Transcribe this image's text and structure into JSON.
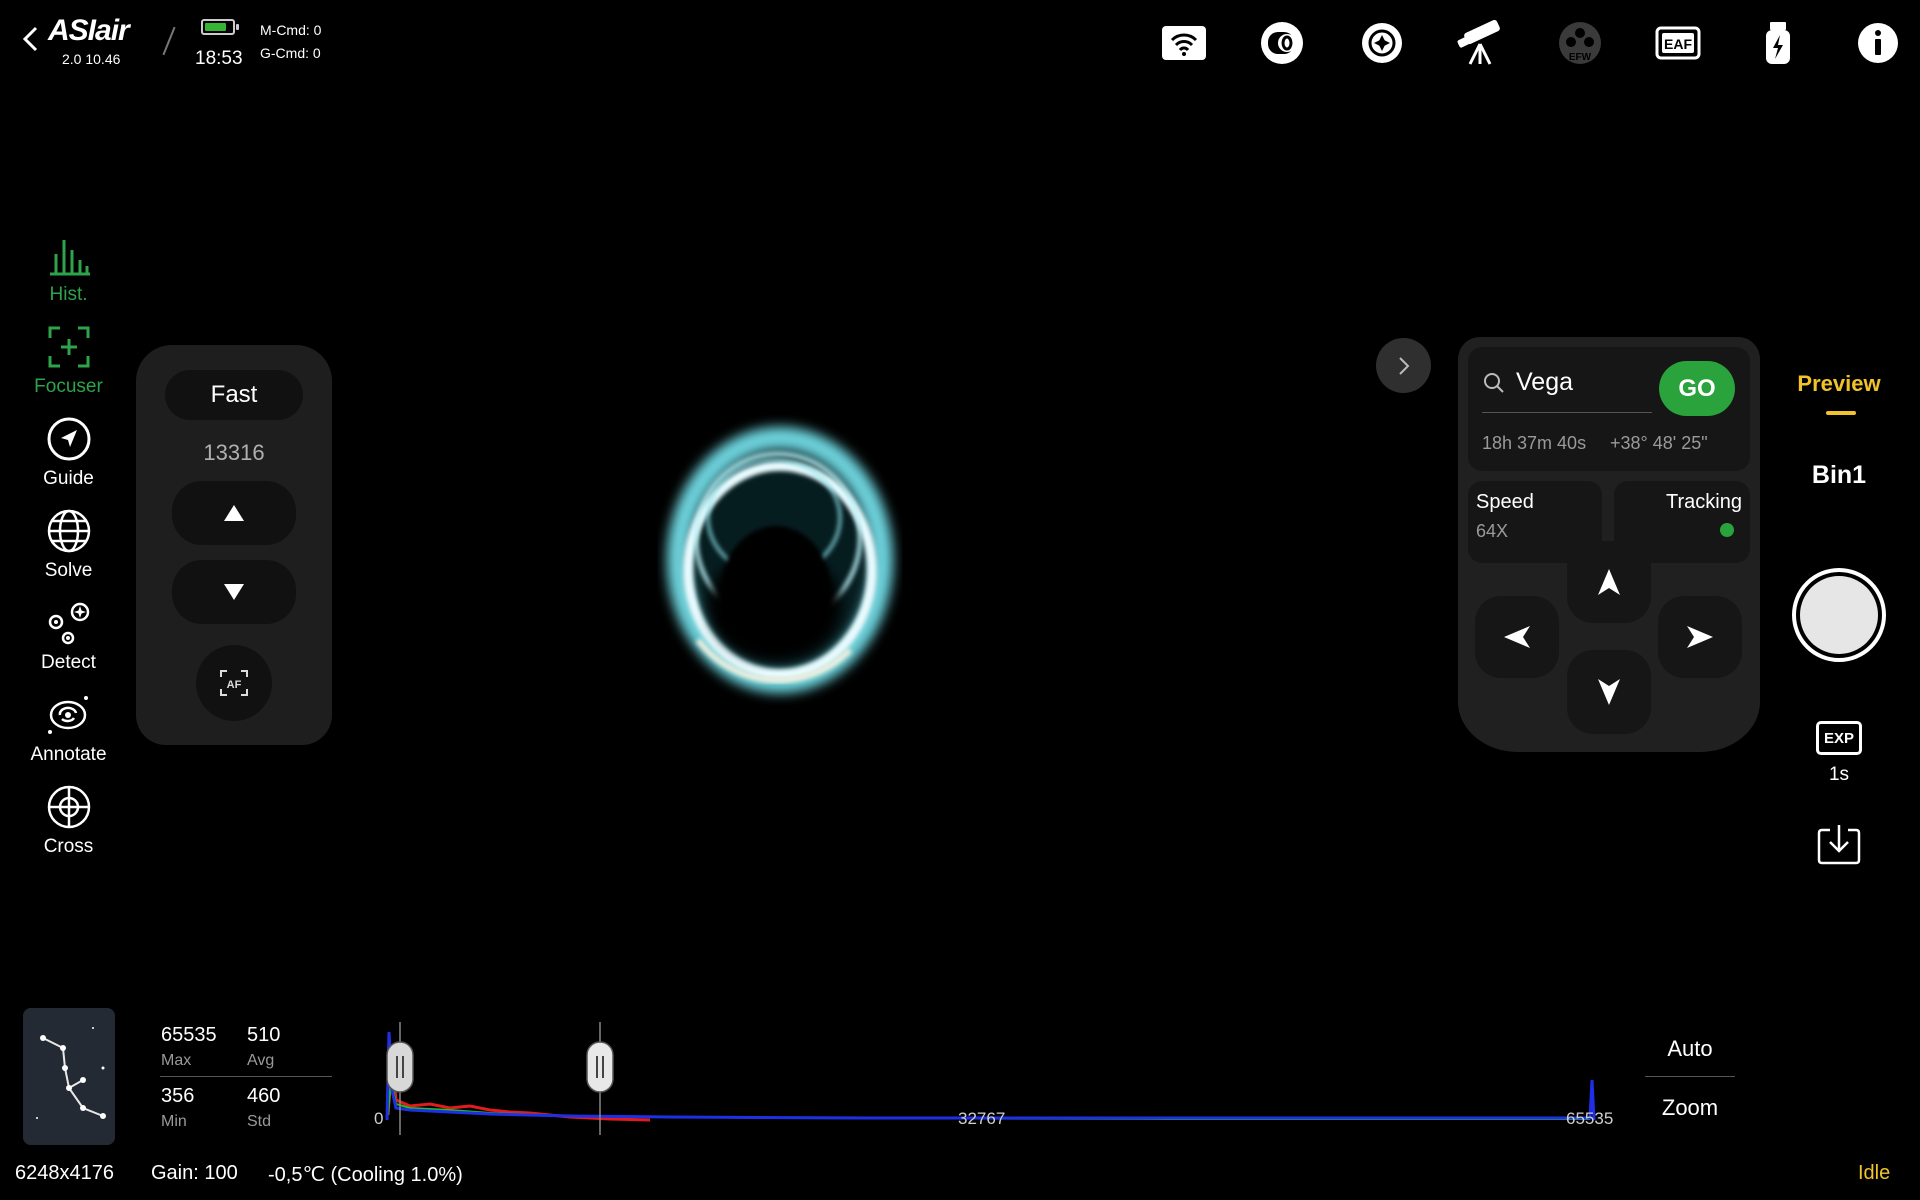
{
  "header": {
    "logo_text": "ASIair",
    "version": "2.0 10.46",
    "time": "18:53",
    "m_cmd": "M-Cmd: 0",
    "g_cmd": "G-Cmd: 0",
    "battery_level": 0.8,
    "battery_color": "#35b435",
    "icons": [
      "wifi-icon",
      "camera-icon",
      "guide-camera-icon",
      "telescope-icon",
      "efw-icon",
      "eaf-icon",
      "usb-storage-icon",
      "info-icon"
    ],
    "efw_label": "EFW",
    "eaf_label": "EAF"
  },
  "left_toolbar": {
    "items": [
      {
        "label": "Hist.",
        "icon": "histogram-icon",
        "active": true
      },
      {
        "label": "Focuser",
        "icon": "focuser-icon",
        "active": true
      },
      {
        "label": "Guide",
        "icon": "guide-icon",
        "active": false
      },
      {
        "label": "Solve",
        "icon": "globe-icon",
        "active": false
      },
      {
        "label": "Detect",
        "icon": "detect-icon",
        "active": false
      },
      {
        "label": "Annotate",
        "icon": "annotate-icon",
        "active": false
      },
      {
        "label": "Cross",
        "icon": "crosshair-icon",
        "active": false
      }
    ],
    "active_color": "#2ea34b"
  },
  "focuser": {
    "mode": "Fast",
    "position": "13316",
    "af_label": "AF"
  },
  "mount": {
    "target": "Vega",
    "go_label": "GO",
    "ra": "18h 37m 40s",
    "dec": "+38° 48' 25\"",
    "speed_label": "Speed",
    "speed_value": "64X",
    "tracking_label": "Tracking",
    "tracking_on": true,
    "tracking_color": "#2aa33c"
  },
  "right_panel": {
    "mode_tab": "Preview",
    "bin": "Bin1",
    "exp_icon": "EXP",
    "exposure": "1s",
    "accent_color": "#f0c32a"
  },
  "histogram": {
    "max_value": "65535",
    "max_label": "Max",
    "avg_value": "510",
    "avg_label": "Avg",
    "min_value": "356",
    "min_label": "Min",
    "std_value": "460",
    "std_label": "Std",
    "tick_min": "0",
    "tick_mid": "32767",
    "tick_max": "65535",
    "black_point": 0.024,
    "white_point": 0.184,
    "auto_label": "Auto",
    "zoom_label": "Zoom"
  },
  "status_bar": {
    "resolution": "6248x4176",
    "gain": "Gain: 100",
    "temperature": "-0,5℃ (Cooling 1.0%)",
    "state": "Idle"
  }
}
